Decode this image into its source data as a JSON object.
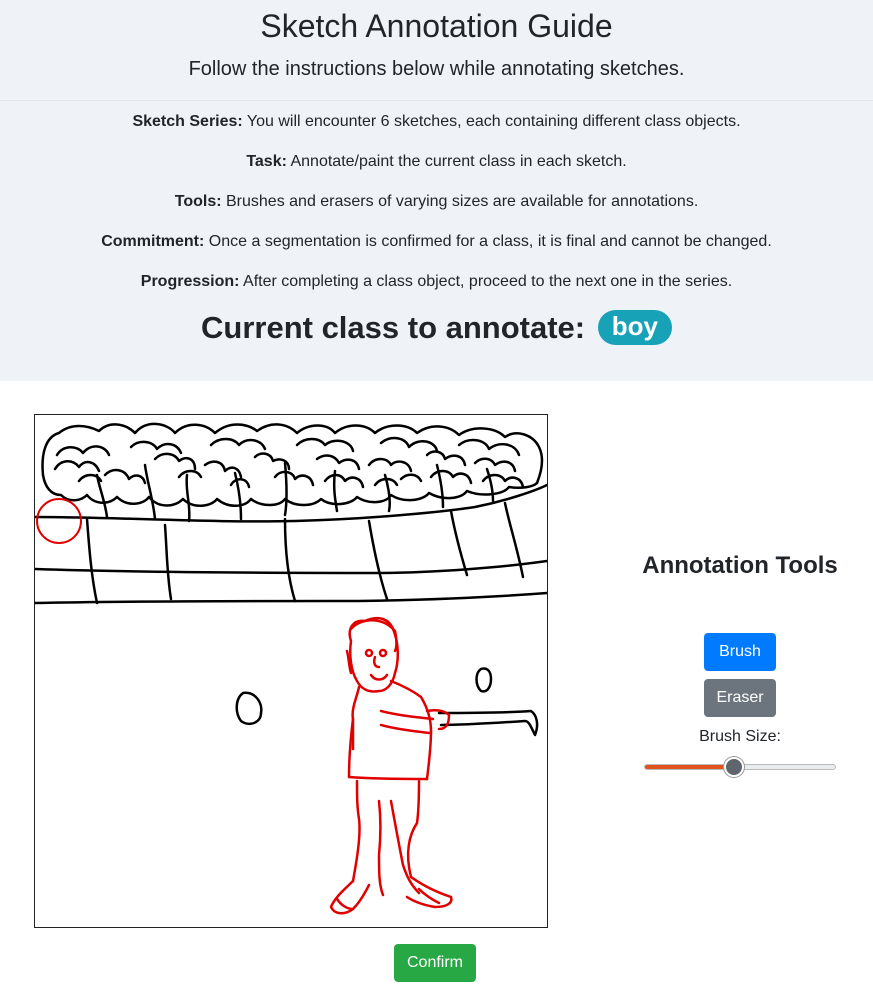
{
  "guide": {
    "title": "Sketch Annotation Guide",
    "subtitle": "Follow the instructions below while annotating sketches.",
    "instructions": [
      {
        "label": "Sketch Series:",
        "text": "You will encounter 6 sketches, each containing different class objects."
      },
      {
        "label": "Task:",
        "text": "Annotate/paint the current class in each sketch."
      },
      {
        "label": "Tools:",
        "text": "Brushes and erasers of varying sizes are available for annotations."
      },
      {
        "label": "Commitment:",
        "text": "Once a segmentation is confirmed for a class, it is final and cannot be changed."
      },
      {
        "label": "Progression:",
        "text": "After completing a class object, proceed to the next one in the series."
      }
    ],
    "current_class_label": "Current class to annotate:",
    "current_class": "boy"
  },
  "tools": {
    "title": "Annotation Tools",
    "brush_label": "Brush",
    "eraser_label": "Eraser",
    "brush_size_label": "Brush Size:",
    "brush_size_fraction": 0.47
  },
  "confirm_label": "Confirm",
  "colors": {
    "annotation": "#e00000",
    "brush_button": "#007bff",
    "eraser_button": "#6c757d",
    "confirm_button": "#28a745",
    "class_badge": "#17a2b8",
    "slider_fill": "#e0531c"
  }
}
